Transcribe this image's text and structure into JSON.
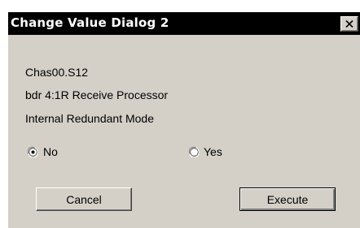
{
  "window": {
    "title": "Change Value Dialog 2",
    "close_icon": "close-icon"
  },
  "info": {
    "device": "Chas00.S12",
    "processor": "bdr 4:1R Receive Processor",
    "mode": "Internal Redundant Mode"
  },
  "options": {
    "no_label": "No",
    "yes_label": "Yes",
    "selected": "No"
  },
  "buttons": {
    "cancel_label": "Cancel",
    "execute_label": "Execute"
  },
  "colors": {
    "titlebar": "#000000",
    "face": "#d4d0c8"
  }
}
